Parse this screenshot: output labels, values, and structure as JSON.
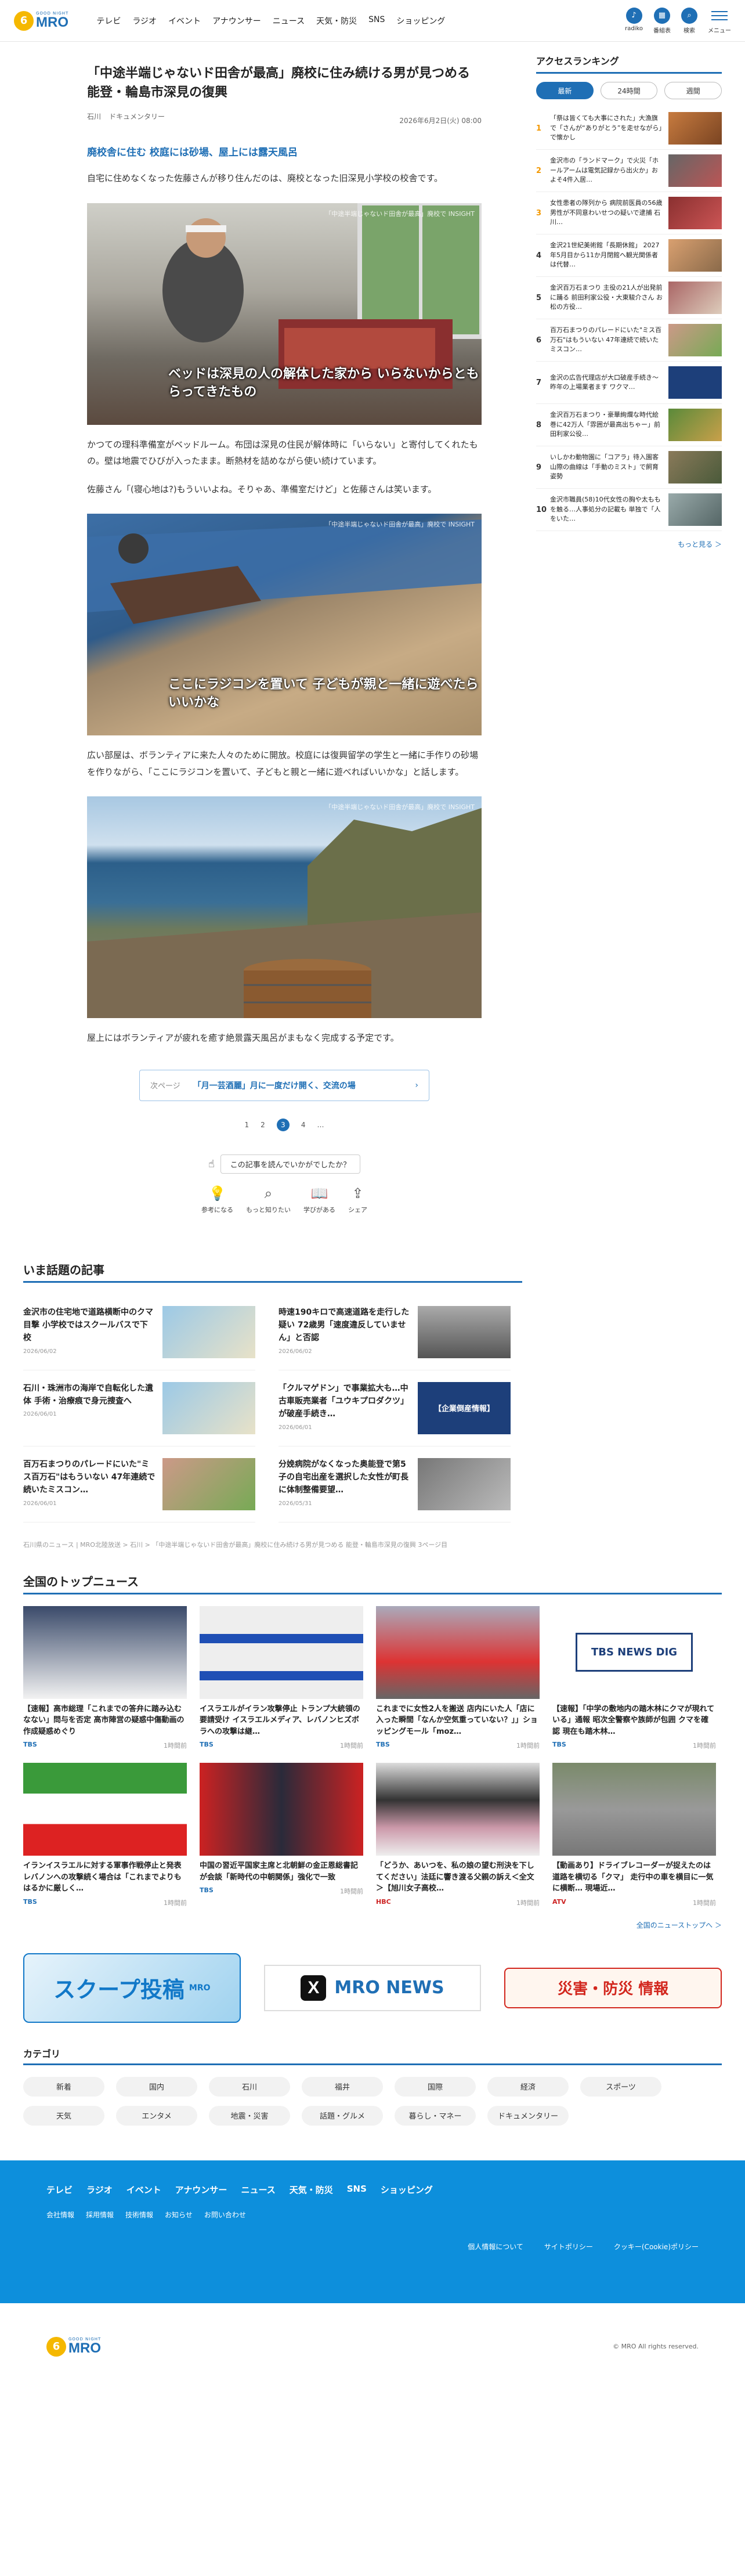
{
  "header": {
    "logo_sub": "GOOD NIGHT",
    "logo_text": "MRO",
    "nav": [
      "テレビ",
      "ラジオ",
      "イベント",
      "アナウンサー",
      "ニュース",
      "天気・防災",
      "SNS",
      "ショッピング"
    ],
    "tools": [
      "radiko",
      "番組表",
      "検索",
      "メニュー"
    ]
  },
  "article": {
    "title": "「中途半端じゃないド田舎が最高」廃校に住み続ける男が見つめる 能登・輪島市深見の復興",
    "tags": [
      "石川",
      "ドキュメンタリー"
    ],
    "date": "2026年6月2日(火) 08:00",
    "subheading": "廃校舎に住む 校庭には砂場、屋上には露天風呂",
    "p1": "自宅に住めなくなった佐藤さんが移り住んだのは、廃校となった旧深見小学校の校舎です。",
    "photo1_wm": "「中途半端じゃないド田舎が最高」廃校で INSIGHT",
    "photo1_cap": "ベッドは深見の人の解体した家から いらないからともらってきたもの",
    "p2": "かつての理科準備室がベッドルーム。布団は深見の住民が解体時に「いらない」と寄付してくれたもの。壁は地震でひびが入ったまま。断熱材を詰めながら使い続けています。",
    "p3": "佐藤さん「(寝心地は?)もういいよね。そりゃあ、準備室だけど」と佐藤さんは笑います。",
    "photo2_wm": "「中途半端じゃないド田舎が最高」廃校で INSIGHT",
    "photo2_cap": "ここにラジコンを置いて 子どもが親と一緒に遊べたらいいかな",
    "p4": "広い部屋は、ボランティアに来た人々のために開放。校庭には復興留学の学生と一緒に手作りの砂場を作りながら、「ここにラジコンを置いて、子どもと親と一緒に遊べればいいかな」と話します。",
    "photo3_wm": "「中途半端じゃないド田舎が最高」廃校で INSIGHT",
    "p5": "屋上にはボランティアが疲れを癒す絶景露天風呂がまもなく完成する予定です。",
    "next_label": "次ページ",
    "next_title": "「月一芸酒麗」月に一度だけ開く、交流の場",
    "pages": [
      "1",
      "2",
      "3",
      "4",
      "…"
    ],
    "current_page": "3",
    "feedback_q": "この記事を読んでいかがでしたか？",
    "reactions": [
      "参考になる",
      "もっと知りたい",
      "学びがある",
      "シェア"
    ]
  },
  "ranking": {
    "title": "アクセスランキング",
    "tabs": [
      "最新",
      "24時間",
      "週間"
    ],
    "active_tab": "最新",
    "items": [
      {
        "no": "1",
        "text": "「祭は皆くても大事にされた」大漁旗で「さんが“ありがとう”を走せながら」で懐かし"
      },
      {
        "no": "2",
        "text": "金沢市の「ランドマーク」で火災「ホールアームは電気記録から出火か」およそ4件入居…"
      },
      {
        "no": "3",
        "text": "女性患者の隊列から 病院前医員の56歳男性が不同意わいせつの疑いで逮捕 石川…"
      },
      {
        "no": "4",
        "text": "金沢21世紀美術館「長期休館」 2027年5月目から11か月閉館へ観光関係者は代替…"
      },
      {
        "no": "5",
        "text": "金沢百万石まつり 主役の21人が出発前に踊る 前田利家公役・大東駿介さん お松の方役…"
      },
      {
        "no": "6",
        "text": "百万石まつりのパレードにいた\"ミス百万石\"はもういない 47年連続で続いたミスコン…"
      },
      {
        "no": "7",
        "text": "金沢の広告代理店が大口破産手続き～ 昨年の上場業者ます ワクマ…"
      },
      {
        "no": "8",
        "text": "金沢百万石まつり・豪華絢爛な時代絵巻に42万人「雰囲が最高出ちゃー」前田利家公役…"
      },
      {
        "no": "9",
        "text": "いしかわ動物園に「コアラ」待入園客 山際の曲線は「手動のミスト」で飼育姿勢"
      },
      {
        "no": "10",
        "text": "金沢市職員(58)10代女性の胸や太ももを触る…人事処分の記載も 単独で「人をいた…"
      }
    ],
    "more": "もっと見る ＞"
  },
  "topics": {
    "heading": "いま話題の記事",
    "items": [
      {
        "title": "金沢市の住宅地で道路横断中のクマ目撃 小学校ではスクールバスで下校",
        "date": "2026/06/02"
      },
      {
        "title": "時速190キロで高速道路を走行した疑い 72歳男「速度違反していません」と否認",
        "date": "2026/06/02"
      },
      {
        "title": "石川・珠洲市の海岸で自転化した遺体 手術・治療痕で身元捜査へ",
        "date": "2026/06/01"
      },
      {
        "title": "「クルマゲドン」で事業拡大も…中古車販売業者「ユウキプロダクツ」が破産手続き…",
        "date": "2026/06/01"
      },
      {
        "title": "百万石まつりのパレードにいた\"ミス百万石\"はもういない 47年連続で続いたミスコン…",
        "date": "2026/06/01"
      },
      {
        "title": "分娩病院がなくなった奥能登で第5子の自宅出産を選択した女性が町長に体制整備要望…",
        "date": "2026/05/31"
      }
    ],
    "thumb4_text": "【企業倒産情報】"
  },
  "breadcrumb": "石川県のニュース | MRO北陸放送 > 石川 > 「中途半端じゃないド田舎が最高」廃校に住み続ける男が見つめる 能登・輪島市深見の復興 3ページ目",
  "national": {
    "heading": "全国のトップニュース",
    "items": [
      {
        "title": "【速報】高市総理「これまでの答弁に踏み込むなない」問与を否定 高市陣営の疑惑中傷動画の作成疑惑めぐり",
        "source": "TBS",
        "time": "1時間前"
      },
      {
        "title": "イスラエルがイラン攻撃停止 トランプ大統領の要請受け イスラエルメディア、レバノンヒズボラへの攻撃は継…",
        "source": "TBS",
        "time": "1時間前"
      },
      {
        "title": "これまでに女性2人を搬送 店内にいた人「店に入った瞬間「なんか空気重っていない？」」ショッピングモール「moz…",
        "source": "TBS",
        "time": "1時間前"
      },
      {
        "title": "【速報】「中学の敷地内の踏木林にクマが現れている」通報 昭次全警察や族師が包囲 クマを確認 現在も踏木林…",
        "source": "TBS",
        "time": "1時間前"
      },
      {
        "title": "イランイスラエルに対する軍事作戦停止と発表 レバノンへの攻撃続く場合は「これまでよりもはるかに厳しく…",
        "source": "TBS",
        "time": "1時間前"
      },
      {
        "title": "中国の習近平国家主席と北朝鮮の金正恩総書記が会談「新時代の中朝関係」強化で一致",
        "source": "TBS",
        "time": "1時間前"
      },
      {
        "title": "「どうか、あいつを、私の娘の望む刑決を下してください」法廷に響き渡る父親の訴え＜全文＞【旭川女子高校…",
        "source": "HBC",
        "time": "1時間前"
      },
      {
        "title": "【動画あり】ドライブレコーダーが捉えたのは道路を横切る「クマ」 走行中の車を横目に一気に横断… 現場近…",
        "source": "ATV",
        "time": "1時間前"
      }
    ],
    "tbs_logo": "TBS NEWS DIG",
    "more": "全国のニューストップへ ＞"
  },
  "banners": {
    "scoop": "スクープ投稿",
    "scoop_sub": "MRO",
    "news_x": "X",
    "news": "MRO NEWS",
    "saigai": "災害・防災 情報"
  },
  "categories": {
    "heading": "カテゴリ",
    "items": [
      "新着",
      "国内",
      "石川",
      "福井",
      "国際",
      "経済",
      "スポーツ",
      "天気",
      "エンタメ",
      "地震・災害",
      "話題・グルメ",
      "暮らし・マネー",
      "ドキュメンタリー"
    ]
  },
  "footer": {
    "nav": [
      "テレビ",
      "ラジオ",
      "イベント",
      "アナウンサー",
      "ニュース",
      "天気・防災",
      "SNS",
      "ショッピング"
    ],
    "sub": [
      "会社情報",
      "採用情報",
      "技術情報",
      "お知らせ",
      "お問い合わせ"
    ],
    "legal": [
      "個人情報について",
      "サイトポリシー",
      "クッキー(Cookie)ポリシー"
    ],
    "copyright": "© MRO All rights reserved."
  }
}
